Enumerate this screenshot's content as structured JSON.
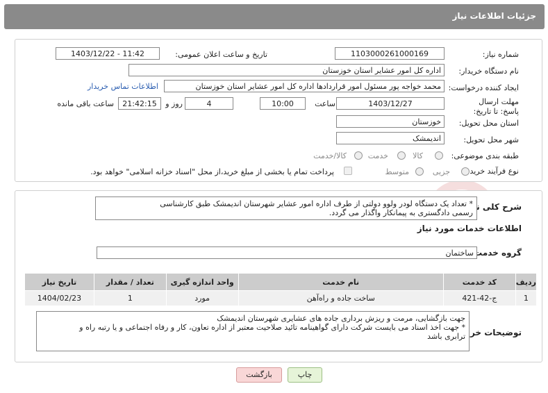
{
  "header": {
    "title": "جزئیات اطلاعات نیاز"
  },
  "need_number": {
    "label": "شماره نیاز:",
    "value": "1103000261000169"
  },
  "announce_datetime": {
    "label": "تاریخ و ساعت اعلان عمومی:",
    "value": "1403/12/22 - 11:42"
  },
  "buyer_org": {
    "label": "نام دستگاه خریدار:",
    "value": "اداره کل امور عشایر استان خوزستان"
  },
  "requester": {
    "label": "ایجاد کننده درخواست:",
    "value": "محمد خواجه پور مسئول امور قراردادها اداره کل امور عشایر استان خوزستان",
    "contact_link": "اطلاعات تماس خریدار"
  },
  "deadline": {
    "label": "مهلت ارسال پاسخ: تا تاریخ:",
    "date": "1403/12/27",
    "time_label": "ساعت",
    "time": "10:00",
    "days": "4",
    "days_label": "روز و",
    "remaining": "21:42:15",
    "remaining_label": "ساعت باقی مانده"
  },
  "province": {
    "label": "استان محل تحویل:",
    "value": "خوزستان"
  },
  "city": {
    "label": "شهر محل تحویل:",
    "value": "اندیمشک"
  },
  "category": {
    "label": "طبقه بندی موضوعی:",
    "options": [
      "کالا",
      "خدمت",
      "کالا/خدمت"
    ]
  },
  "purchase_type": {
    "label": "نوع فرآیند خرید :",
    "options": [
      "جزیی",
      "متوسط"
    ],
    "note": "پرداخت تمام یا بخشی از مبلغ خرید،از محل \"اسناد خزانه اسلامی\" خواهد بود."
  },
  "description": {
    "label": "شرح کلی نیاز:",
    "line1": "* تعداد یک  دستگاه  لودر ولوو  دولتی از طرف اداره امور عشایر شهرستان اندیمشک    طبق کارشناسی",
    "line2": "رسمی دادگستری به پیمانکار واگذار می گردد."
  },
  "services_title": "اطلاعات خدمات مورد نیاز",
  "service_group": {
    "label": "گروه خدمت:",
    "value": "ساختمان"
  },
  "table": {
    "headers": [
      "ردیف",
      "کد خدمت",
      "نام خدمت",
      "واحد اندازه گیری",
      "تعداد / مقدار",
      "تاریخ نیاز"
    ],
    "rows": [
      [
        "1",
        "ج-42-421",
        "ساخت جاده و راه‌آهن",
        "مورد",
        "1",
        "1404/02/23"
      ]
    ]
  },
  "buyer_notes": {
    "label": "توضیحات خریدار:",
    "line1": "جهت بازگشایی، مرمت و ریزش برداری  جاده های عشایری شهرستان اندیمشک",
    "line2": "* جهت اخذ اسناد می بایست شرکت دارای گواهینامه تائید صلاحیت معتبر از اداره تعاون، کار  و رفاه اجتماعی و یا رتبه راه و",
    "line3": "ترابری  باشد"
  },
  "buttons": {
    "print": "چاپ",
    "back": "بازگشت"
  },
  "watermark": {
    "text": "AriaTender.neT"
  },
  "colors": {
    "header_bg": "#8a8a8a",
    "link": "#2a5db0",
    "print_btn": "#e6f4d8",
    "back_btn": "#f9d7d7",
    "watermark": "#f0c6c6"
  }
}
